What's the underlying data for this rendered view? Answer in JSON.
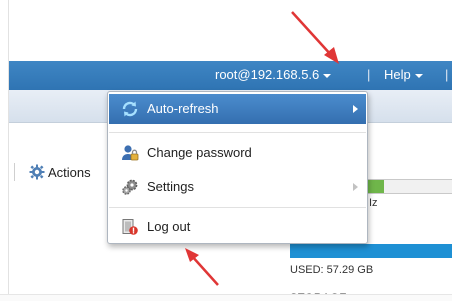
{
  "header": {
    "user_label": "root@192.168.5.6",
    "separator": "|",
    "help_label": "Help",
    "accent_color": "#3a7fbf"
  },
  "toolbar": {
    "actions_label": "Actions"
  },
  "background": {
    "unit_label": "Iz",
    "used_label": "USED: 57.29 GB",
    "storage_label": "STORAGE"
  },
  "menu": {
    "items": [
      {
        "label": "Auto-refresh",
        "icon": "refresh-icon",
        "has_submenu": true,
        "highlighted": true
      },
      {
        "label": "Change password",
        "icon": "user-lock-icon",
        "has_submenu": false
      },
      {
        "label": "Settings",
        "icon": "gears-icon",
        "has_submenu": true
      },
      {
        "label": "Log out",
        "icon": "logout-icon",
        "has_submenu": false
      }
    ]
  }
}
